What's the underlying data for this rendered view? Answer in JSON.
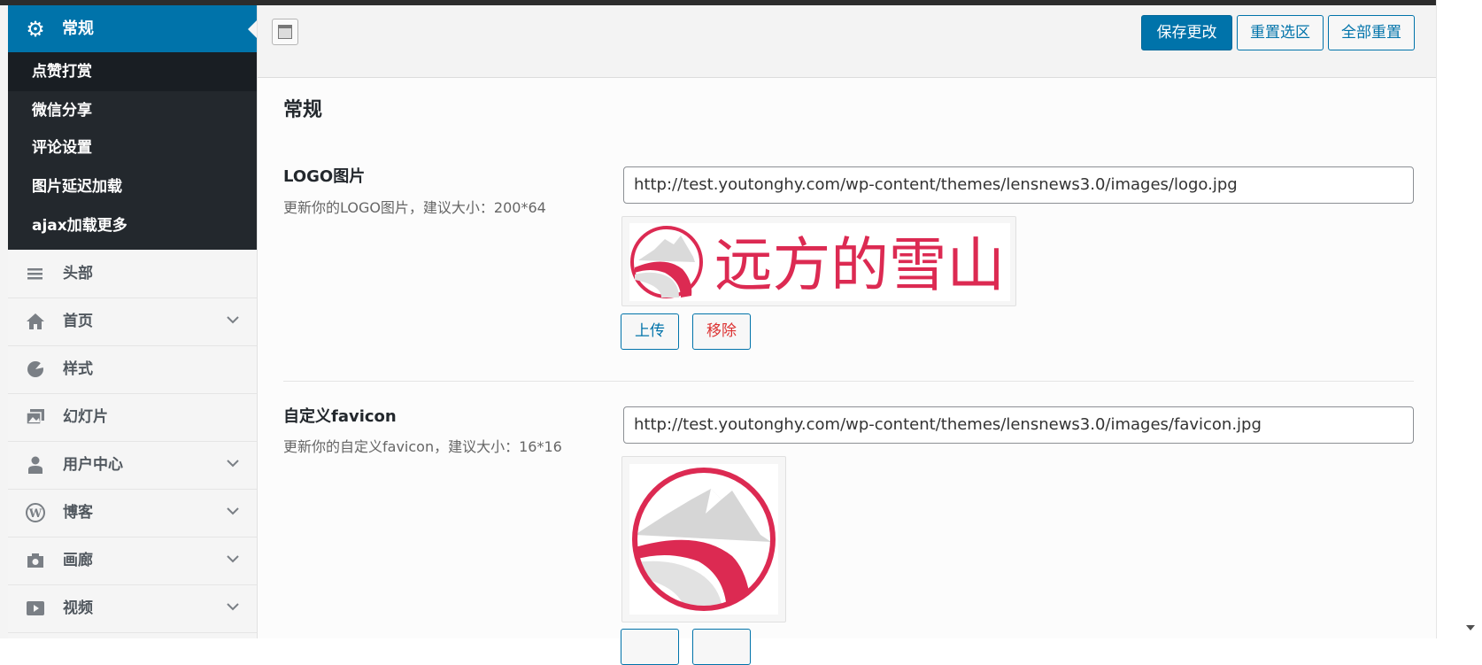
{
  "sidebar": {
    "active": {
      "label": "常规",
      "icon": "gear-icon"
    },
    "submenu": [
      {
        "label": "点赞打赏"
      },
      {
        "label": "微信分享"
      },
      {
        "label": "评论设置"
      },
      {
        "label": "图片延迟加载"
      },
      {
        "label": "ajax加载更多"
      }
    ],
    "items": [
      {
        "label": "头部",
        "icon": "menu-icon"
      },
      {
        "label": "首页",
        "icon": "home-icon"
      },
      {
        "label": "样式",
        "icon": "palette-icon"
      },
      {
        "label": "幻灯片",
        "icon": "images-icon"
      },
      {
        "label": "用户中心",
        "icon": "user-icon"
      },
      {
        "label": "博客",
        "icon": "wordpress-icon"
      },
      {
        "label": "画廊",
        "icon": "camera-icon"
      },
      {
        "label": "视频",
        "icon": "video-icon"
      }
    ]
  },
  "toolbar": {
    "save_label": "保存更改",
    "reset_section_label": "重置选区",
    "reset_all_label": "全部重置"
  },
  "section": {
    "title": "常规"
  },
  "fields": {
    "logo": {
      "title": "LOGO图片",
      "desc": "更新你的LOGO图片，建议大小：200*64",
      "value": "http://test.youtonghy.com/wp-content/themes/lensnews3.0/images/logo.jpg",
      "preview_text": "远方的雪山",
      "upload_label": "上传",
      "remove_label": "移除"
    },
    "favicon": {
      "title": "自定义favicon",
      "desc": "更新你的自定义favicon，建议大小：16*16",
      "value": "http://test.youtonghy.com/wp-content/themes/lensnews3.0/images/favicon.jpg"
    }
  },
  "colors": {
    "accent": "#0073aa",
    "sidebar_dark": "#23282d",
    "logo_red": "#dc2a52",
    "remove_red": "#dc3232"
  }
}
